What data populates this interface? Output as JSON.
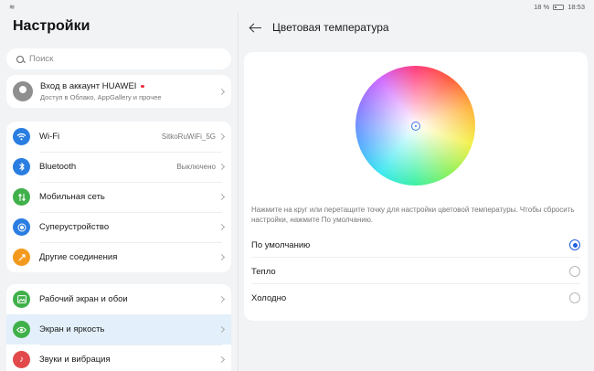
{
  "statusbar": {
    "battery": "18 %",
    "time": "18:53"
  },
  "left": {
    "title": "Настройки",
    "search_placeholder": "Поиск",
    "account": {
      "name": "Вход в аккаунт HUAWEI",
      "subtitle": "Доступ в Облако, AppGallery и прочее"
    },
    "network_items": [
      {
        "label": "Wi-Fi",
        "value": "SitkoRuWiFi_5G",
        "icon": "wifi-icon",
        "color": "#2a7de1"
      },
      {
        "label": "Bluetooth",
        "value": "Выключено",
        "icon": "bluetooth-icon",
        "color": "#2a7de1"
      },
      {
        "label": "Мобильная сеть",
        "value": "",
        "icon": "mobile-network-icon",
        "color": "#40b04a"
      },
      {
        "label": "Суперустройство",
        "value": "",
        "icon": "super-device-icon",
        "color": "#2a7de1"
      },
      {
        "label": "Другие соединения",
        "value": "",
        "icon": "link-icon",
        "color": "#f39a1e"
      }
    ],
    "display_items": [
      {
        "label": "Рабочий экран и обои",
        "icon": "wallpaper-icon",
        "color": "#40b04a"
      },
      {
        "label": "Экран и яркость",
        "icon": "eye-icon",
        "color": "#40b04a"
      },
      {
        "label": "Звуки и вибрация",
        "icon": "sound-icon",
        "color": "#e2494a"
      }
    ]
  },
  "right": {
    "title": "Цветовая температура",
    "description": "Нажмите на круг или перетащите точку для настройки цветовой температуры. Чтобы сбросить настройки, нажмите По умолчанию.",
    "options": [
      {
        "label": "По умолчанию",
        "selected": true
      },
      {
        "label": "Тепло",
        "selected": false
      },
      {
        "label": "Холодно",
        "selected": false
      }
    ]
  },
  "colors": {
    "accent": "#1f5fe0",
    "active_row": "#e3f0fb"
  }
}
